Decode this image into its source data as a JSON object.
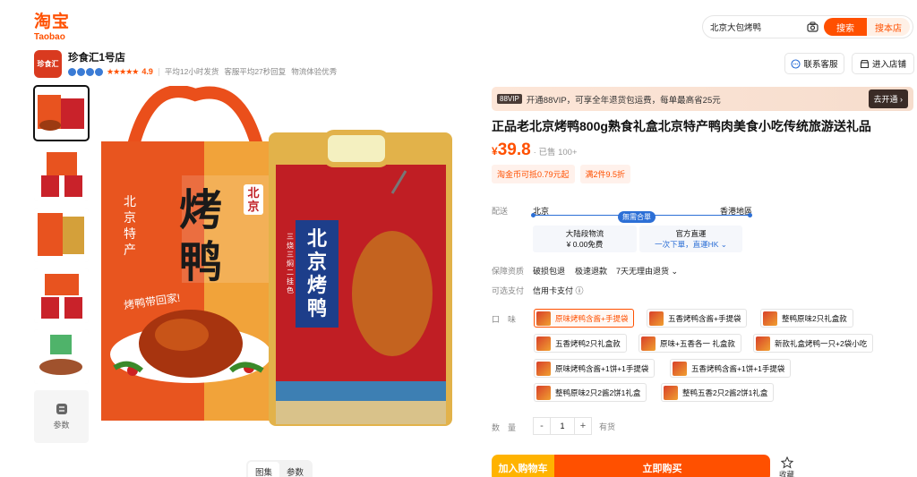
{
  "header": {
    "logo_cn": "淘宝",
    "logo_en": "Taobao",
    "search_value": "北京大包烤鸭",
    "search_button": "搜索",
    "store_search_button": "搜本店"
  },
  "shop": {
    "logo_text": "珍食汇",
    "name": "珍食汇1号店",
    "stars": "★★★★★",
    "score": "4.9",
    "meta": [
      "平均12小时发货",
      "客服平均27秒回复",
      "物流体验优秀"
    ],
    "service_button": "联系客服",
    "enter_button": "进入店铺"
  },
  "gallery": {
    "params_label": "参数",
    "tabs": [
      "图集",
      "参数"
    ],
    "bag_left_text": "北京特产",
    "bag_title": "烤鸭",
    "bag_badge": "北京",
    "bag_slogan": "烤鸭带回家!",
    "pack_title": "北京烤鸭",
    "pack_side": "三烧三焖二挂色"
  },
  "product": {
    "vip_badge": "88VIP",
    "vip_text": "开通88VIP，可享全年退货包运费，每单最高省25元",
    "vip_button": "去开通 ›",
    "title": "正品老北京烤鸭800g熟食礼盒北京特产鸭肉美食小吃传统旅游送礼品",
    "price_symbol": "¥",
    "price": "39.8",
    "sold": "· 已售 100+",
    "coupons": [
      "淘金币可抵0.79元起",
      "满2件9.5折"
    ]
  },
  "shipping": {
    "label": "配送",
    "from": "北京",
    "to": "香港地區",
    "badge": "無需合單",
    "box1_title": "大陆段物流",
    "box1_sub": "¥ 0.00免费",
    "box2_title": "官方直運",
    "box2_link": "一次下單，直運HK ⌄"
  },
  "guarantee": {
    "label": "保障资质",
    "items": [
      "破损包退",
      "极速退款",
      "7天无理由退货 ⌄"
    ]
  },
  "payment": {
    "label": "可选支付",
    "value": "信用卡支付 ⓘ"
  },
  "flavor": {
    "label": "口　味",
    "options": [
      "原味烤鸭含酱+手提袋",
      "五香烤鸭含酱+手提袋",
      "整鸭原味2只礼盒款",
      "五香烤鸭2只礼盒款",
      "原味+五香各一 礼盒款",
      "新款礼盒烤鸭一只+2袋小吃",
      "原味烤鸭含酱+1饼+1手提袋",
      "五香烤鸭含酱+1饼+1手提袋",
      "整鸭原味2只2酱2饼1礼盒",
      "整鸭五香2只2酱2饼1礼盒"
    ]
  },
  "quantity": {
    "label": "数　量",
    "minus": "-",
    "value": "1",
    "plus": "+",
    "stock": "有货"
  },
  "actions": {
    "cart": "加入购物车",
    "buy": "立即购买",
    "favorite": "收藏"
  }
}
